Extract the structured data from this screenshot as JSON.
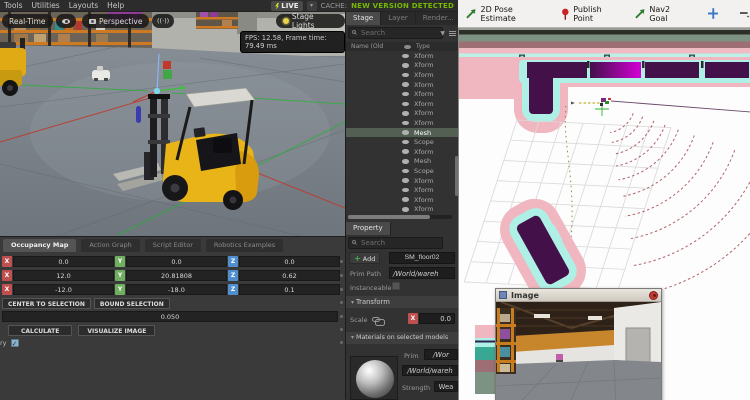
{
  "window": {
    "menu": [
      "Tools",
      "Utilities",
      "Layouts",
      "Help"
    ],
    "live_label": "LIVE",
    "cache_label": "CACHE:",
    "version_banner": "NEW VERSION DETECTED"
  },
  "viewport": {
    "realtime_label": "Real-Time",
    "perspective_label": "Perspective",
    "signal_glyph": "((·))",
    "stage_lights_label": "Stage Lights",
    "fps_tooltip": "FPS: 12.58, Frame time: 79.49 ms"
  },
  "stage_panel": {
    "tabs": [
      "Stage",
      "Layer",
      "Render..."
    ],
    "search_placeholder": "Search",
    "col_name": "Name (Old",
    "col_type": "Type",
    "rows": [
      "Xform",
      "Xform",
      "Xform",
      "Xform",
      "Xform",
      "Xform",
      "Xform",
      "Xform",
      "Mesh",
      "Scope",
      "Xform",
      "Mesh",
      "Scope",
      "Xform",
      "Xform",
      "Xform",
      "Xform"
    ],
    "selected_row": 8
  },
  "occupancy_panel": {
    "tabs": [
      "Occupancy Map",
      "Action Graph",
      "Script Editor",
      "Robotics Examples"
    ],
    "axes": [
      "X",
      "Y",
      "Z"
    ],
    "origin": {
      "x": "0.0",
      "y": "0.0",
      "z": "0.0"
    },
    "upper": {
      "x": "12.0",
      "y": "20.81808",
      "z": "0.62"
    },
    "lower": {
      "x": "-12.0",
      "y": "-18.0",
      "z": "0.1"
    },
    "center_btn": "CENTER TO SELECTION",
    "bound_btn": "BOUND SELECTION",
    "cell_size": "0.050",
    "calculate_btn": "CALCULATE",
    "visualize_btn": "VISUALIZE IMAGE",
    "checkbox_label": "ry",
    "checkbox_checked": "✓"
  },
  "property_panel": {
    "tab": "Property",
    "search_placeholder": "Search",
    "add_btn": "Add",
    "name_value": "SM_floor02",
    "prim_path_label": "Prim Path",
    "prim_path_value": "/World/wareh",
    "instanceable_label": "Instanceable",
    "transform_section": "Transform",
    "scale_label": "Scale",
    "scale_axis": "X",
    "scale_value": "0.0",
    "materials_section": "Materials on selected models",
    "prim_label": "Prim",
    "prim_value": "/Wor",
    "material_path": "/World/wareh",
    "strength_label": "Strength",
    "strength_value": "Wea"
  },
  "rviz": {
    "tool_pose": "2D Pose Estimate",
    "tool_publish": "Publish Point",
    "tool_nav": "Nav2 Goal",
    "image_window_title": "Image"
  },
  "icons": {
    "live": "lightning-icon",
    "viewport_left": [
      "eye-icon",
      "camera-icon",
      "signal-icon"
    ],
    "stage_lights": "sun-icon",
    "search": "magnifier-icon",
    "filter": "funnel-icon",
    "menu": "hamburger-icon",
    "tree_visibility": "eye-icon",
    "pose_tool": "green-arrow-icon",
    "publish_tool": "red-pin-icon",
    "nav_tool": "green-arrow-icon",
    "pan_tool": "blue-plus-icon",
    "zoom_tool": "minus-icon",
    "image_window": "image-icon",
    "close": "red-close-icon"
  },
  "colors": {
    "accent_green": "#76b900",
    "axis_x": "#c05050",
    "axis_y": "#6faf5f",
    "axis_z": "#4f8fd0",
    "map_sage": "#7c9282",
    "map_maroon": "#9d6f75",
    "map_pink": "#f0b7c0",
    "map_cyan": "#aef0e6",
    "map_purple": "#43104a",
    "map_magenta": "#cc00cc",
    "scan_red": "#a5454f",
    "forklift_yellow": "#e9b417"
  }
}
